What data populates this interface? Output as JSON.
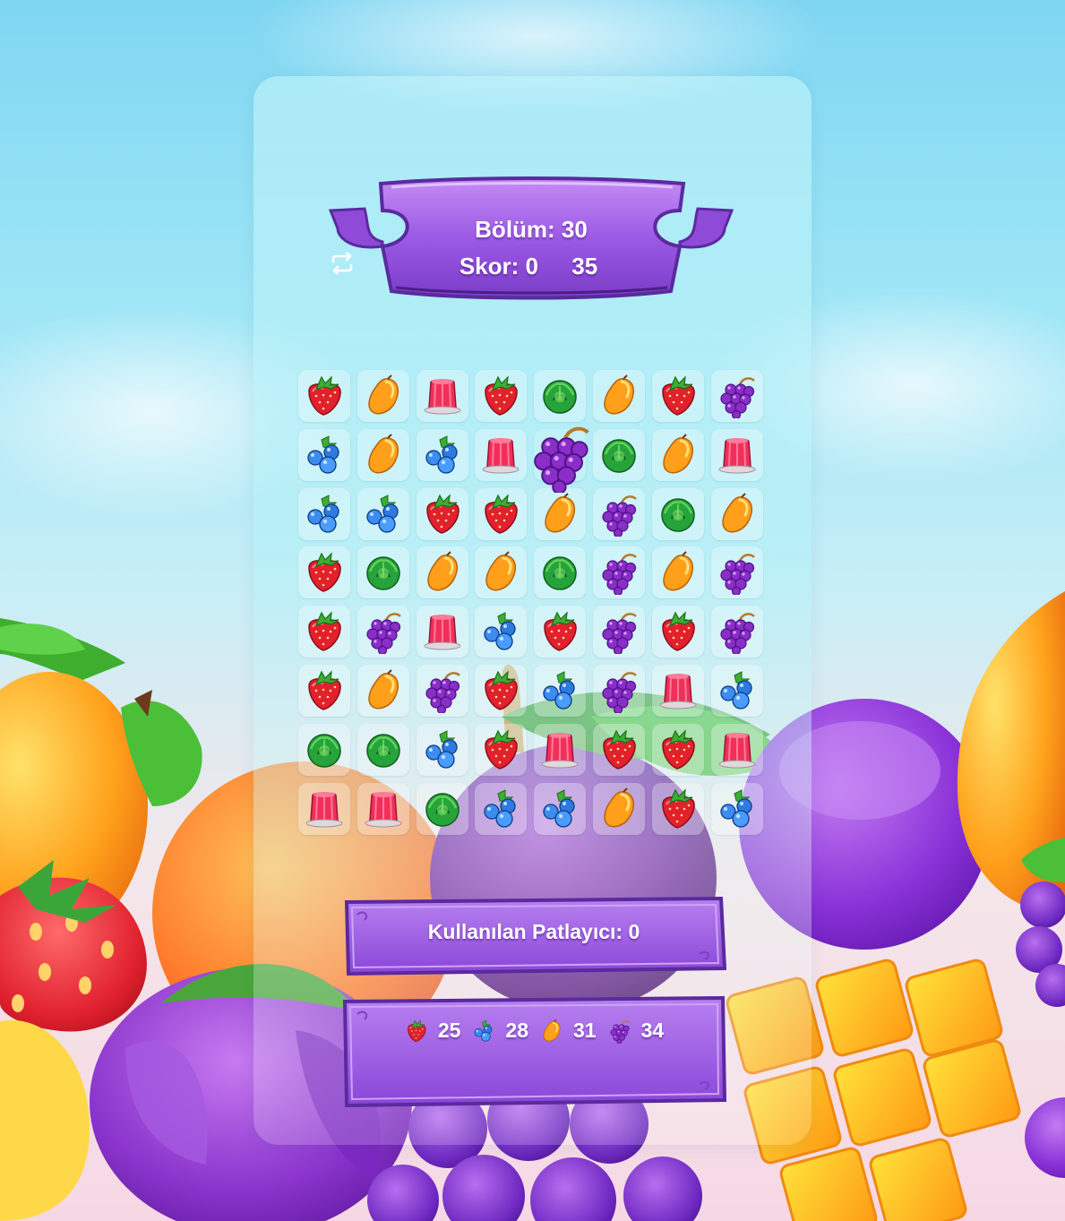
{
  "header": {
    "level_label": "Bölüm: 30",
    "score_label": "Skor: 0",
    "moves": "35",
    "moves_icon": "repeat-icon"
  },
  "board": {
    "rows": [
      [
        "strawberry",
        "mango",
        "jelly",
        "strawberry",
        "cabbage",
        "mango",
        "strawberry",
        "grape"
      ],
      [
        "blueberry",
        "mango",
        "blueberry",
        "jelly",
        "grape",
        "cabbage",
        "mango",
        "jelly"
      ],
      [
        "blueberry",
        "blueberry",
        "strawberry",
        "strawberry",
        "mango",
        "grape",
        "cabbage",
        "mango"
      ],
      [
        "strawberry",
        "cabbage",
        "mango",
        "mango",
        "cabbage",
        "grape",
        "mango",
        "grape"
      ],
      [
        "strawberry",
        "grape",
        "jelly",
        "blueberry",
        "strawberry",
        "grape",
        "strawberry",
        "grape"
      ],
      [
        "strawberry",
        "mango",
        "grape",
        "strawberry",
        "blueberry",
        "grape",
        "jelly",
        "blueberry"
      ],
      [
        "cabbage",
        "cabbage",
        "blueberry",
        "strawberry",
        "jelly",
        "strawberry",
        "strawberry",
        "jelly"
      ],
      [
        "jelly",
        "jelly",
        "cabbage",
        "blueberry",
        "blueberry",
        "mango",
        "strawberry",
        "blueberry"
      ]
    ],
    "dragged_piece": "grape"
  },
  "boosters": {
    "label": "Kullanılan Patlayıcı: 0"
  },
  "goals": [
    {
      "icon": "strawberry",
      "count": "25"
    },
    {
      "icon": "blueberry",
      "count": "28"
    },
    {
      "icon": "mango",
      "count": "31"
    },
    {
      "icon": "grape",
      "count": "34"
    }
  ],
  "colors": {
    "banner_purple": "#9b5ce0",
    "banner_dark": "#5a2a9e",
    "panel_tint": "#bff3f8"
  }
}
